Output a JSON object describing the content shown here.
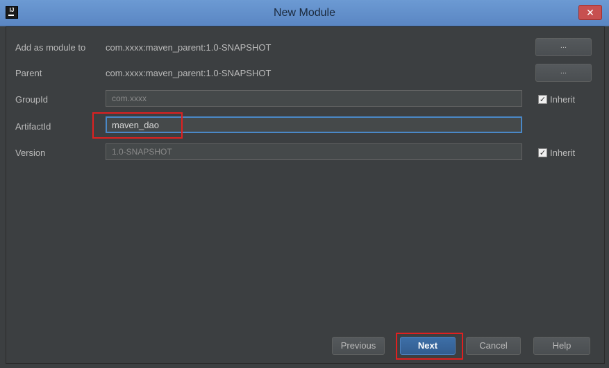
{
  "window": {
    "title": "New Module",
    "app_icon": "IJ",
    "close_glyph": "✕"
  },
  "form": {
    "add_as_module_label": "Add as module to",
    "add_as_module_value": "com.xxxx:maven_parent:1.0-SNAPSHOT",
    "parent_label": "Parent",
    "parent_value": "com.xxxx:maven_parent:1.0-SNAPSHOT",
    "browse_label": "...",
    "groupid_label": "GroupId",
    "groupid_value": "com.xxxx",
    "artifactid_label": "ArtifactId",
    "artifactid_value": "maven_dao",
    "version_label": "Version",
    "version_value": "1.0-SNAPSHOT",
    "inherit_label": "Inherit",
    "check_glyph": "✓"
  },
  "buttons": {
    "previous": "Previous",
    "next": "Next",
    "cancel": "Cancel",
    "help": "Help"
  },
  "colors": {
    "background": "#3c3f41",
    "titlebar": "#6c9ad3",
    "accent": "#4a88c7",
    "highlight": "#e02020"
  }
}
